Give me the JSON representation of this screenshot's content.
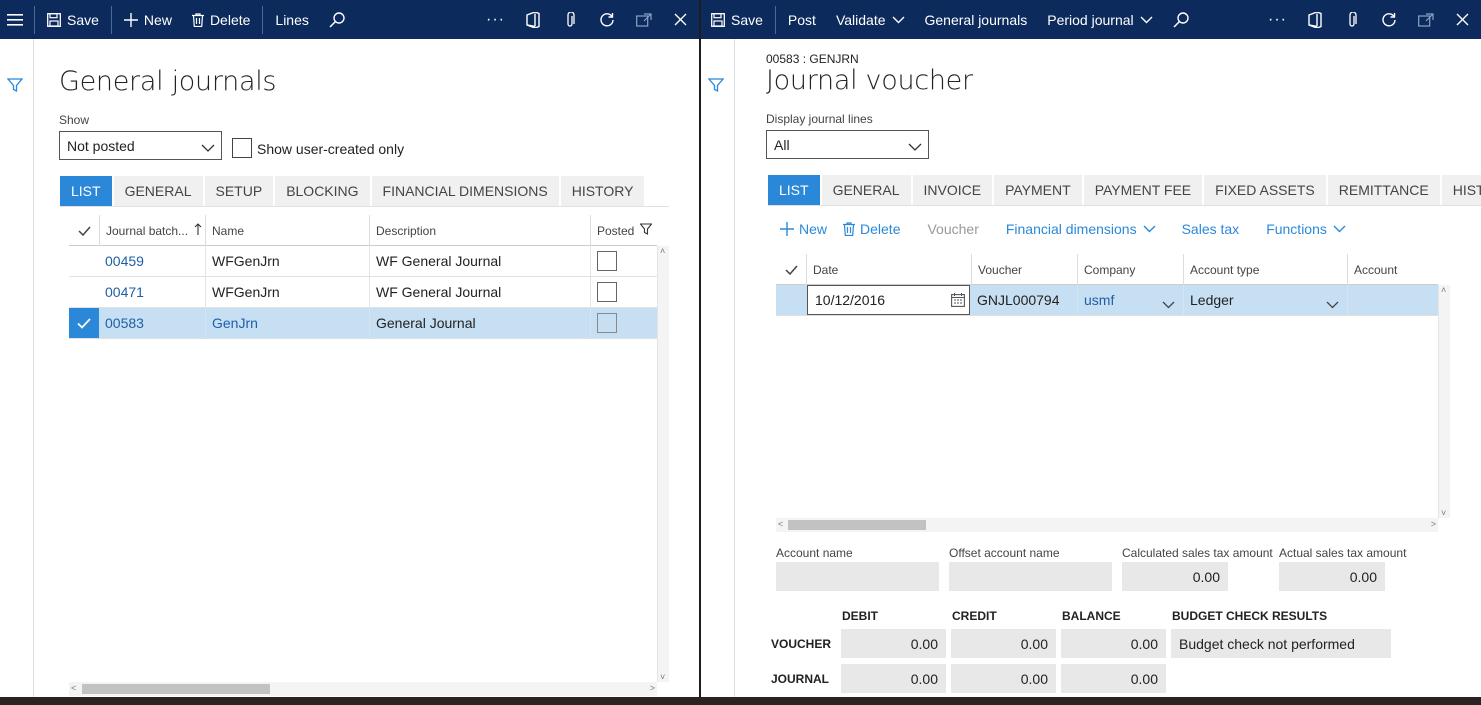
{
  "left": {
    "actionbar": {
      "save": "Save",
      "new": "New",
      "delete": "Delete",
      "lines": "Lines",
      "more": "···"
    },
    "title": "General journals",
    "show_label": "Show",
    "show_value": "Not posted",
    "user_created_label": "Show user-created only",
    "tabs": [
      "LIST",
      "GENERAL",
      "SETUP",
      "BLOCKING",
      "FINANCIAL DIMENSIONS",
      "HISTORY"
    ],
    "grid": {
      "headers": [
        "Journal batch...",
        "Name",
        "Description",
        "Posted"
      ],
      "rows": [
        {
          "batch": "00459",
          "name": "WFGenJrn",
          "description": "WF General Journal",
          "posted": false
        },
        {
          "batch": "00471",
          "name": "WFGenJrn",
          "description": "WF General Journal",
          "posted": false
        },
        {
          "batch": "00583",
          "name": "GenJrn",
          "description": "General Journal",
          "posted": false
        }
      ]
    }
  },
  "right": {
    "actionbar": {
      "save": "Save",
      "post": "Post",
      "validate": "Validate",
      "general_journals": "General journals",
      "period_journal": "Period journal",
      "more": "···"
    },
    "breadcrumb": "00583 : GENJRN",
    "title": "Journal voucher",
    "display_label": "Display journal lines",
    "display_value": "All",
    "tabs": [
      "LIST",
      "GENERAL",
      "INVOICE",
      "PAYMENT",
      "PAYMENT FEE",
      "FIXED ASSETS",
      "REMITTANCE",
      "HISTORY"
    ],
    "commands": {
      "new": "New",
      "delete": "Delete",
      "voucher": "Voucher",
      "financial_dimensions": "Financial dimensions",
      "sales_tax": "Sales tax",
      "functions": "Functions"
    },
    "grid": {
      "headers": [
        "Date",
        "Voucher",
        "Company",
        "Account type",
        "Account"
      ],
      "row": {
        "date": "10/12/2016",
        "voucher": "GNJL000794",
        "company": "usmf",
        "account_type": "Ledger"
      }
    },
    "fields": {
      "account_name": "Account name",
      "offset_account_name": "Offset account name",
      "calc_tax_label": "Calculated sales tax amount",
      "calc_tax_value": "0.00",
      "actual_tax_label": "Actual sales tax amount",
      "actual_tax_value": "0.00"
    },
    "totals": {
      "columns": [
        "DEBIT",
        "CREDIT",
        "BALANCE",
        "BUDGET CHECK RESULTS"
      ],
      "voucher_label": "VOUCHER",
      "journal_label": "JOURNAL",
      "voucher": {
        "debit": "0.00",
        "credit": "0.00",
        "balance": "0.00",
        "budget": "Budget check not performed"
      },
      "journal": {
        "debit": "0.00",
        "credit": "0.00",
        "balance": "0.00"
      }
    }
  },
  "colors": {
    "actionbar": "#0c2a5b",
    "accent": "#2b88d8",
    "selected_row": "#c7dff2",
    "link": "#1e5fa8"
  }
}
